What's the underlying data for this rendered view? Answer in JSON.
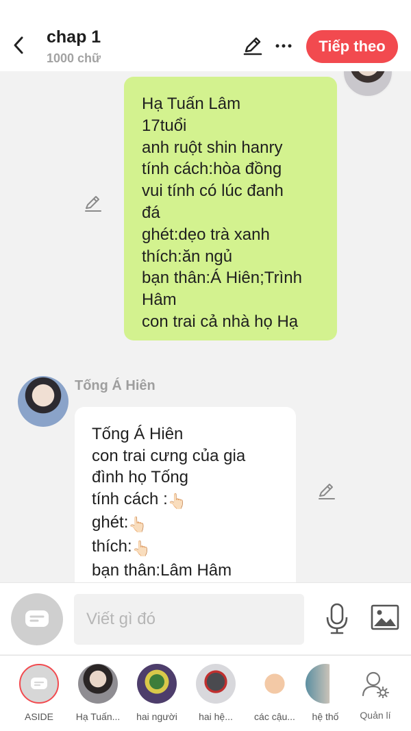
{
  "header": {
    "title": "chap 1",
    "subtitle": "1000 chữ",
    "next_label": "Tiếp theo"
  },
  "messages": {
    "right": {
      "lines": [
        "Hạ Tuấn Lâm",
        "17tuổi",
        "anh ruột shin hanry",
        "tính cách:hòa đồng",
        "vui tính có lúc đanh",
        "đá",
        "ghét:dẹo trà xanh",
        "thích:ăn ngủ",
        "bạn thân:Á Hiên;Trình",
        "Hâm",
        "con trai cả nhà họ Hạ"
      ]
    },
    "left": {
      "sender": "Tống Á Hiên",
      "line1": "Tống Á Hiên",
      "line2": "con trai cưng của gia",
      "line3": "đình họ Tống",
      "line4": "tính cách :",
      "line5": "ghét:",
      "line6": "thích:",
      "line7": "bạn thân:Lâm Hâm",
      "emoji": "👆🏻"
    }
  },
  "input": {
    "placeholder": "Viết gì đó"
  },
  "characters": [
    {
      "label": "ASIDE"
    },
    {
      "label": "Hạ Tuấn..."
    },
    {
      "label": "hai người"
    },
    {
      "label": "hai hệ..."
    },
    {
      "label": "các cậu..."
    },
    {
      "label": "hệ thố"
    }
  ],
  "manage_label": "Quản lí",
  "colors": {
    "accent": "#f24a4f",
    "bubble_green": "#d3f28f",
    "background": "#f2f2f2"
  }
}
